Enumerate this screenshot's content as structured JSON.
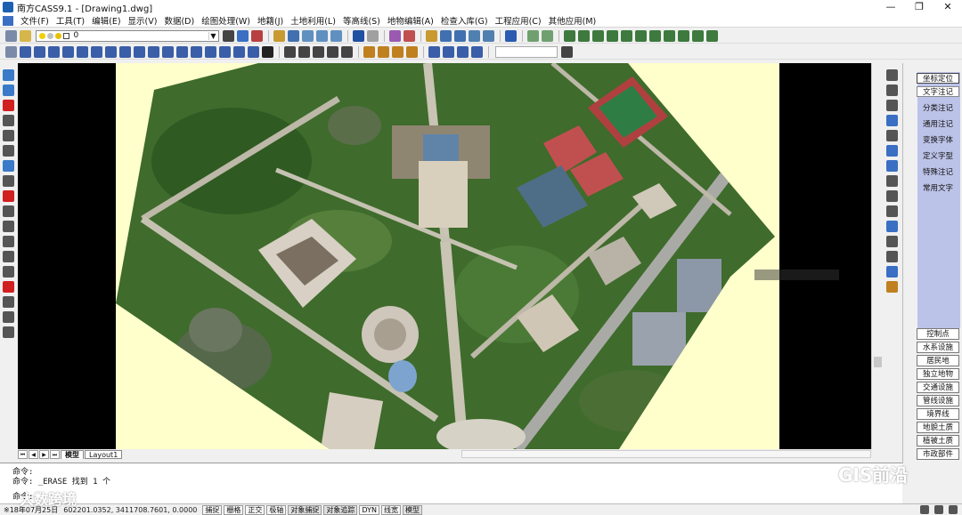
{
  "window": {
    "title": "南方CASS9.1 - [Drawing1.dwg]",
    "controls": [
      "—",
      "❐",
      "✕"
    ]
  },
  "menu": {
    "items": [
      "文件(F)",
      "工具(T)",
      "编辑(E)",
      "显示(V)",
      "数据(D)",
      "绘图处理(W)",
      "地籍(J)",
      "土地利用(L)",
      "等高线(S)",
      "地物编辑(A)",
      "检查入库(G)",
      "工程应用(C)",
      "其他应用(M)"
    ]
  },
  "toolbar": {
    "layer_value": "0"
  },
  "side_panel": {
    "top_buttons": [
      "坐标定位",
      "文字注记",
      "分类注记",
      "通用注记",
      "变换字体",
      "定义字型",
      "特殊注记",
      "常用文字"
    ],
    "selected_top": "坐标定位",
    "bottom_buttons": [
      "控制点",
      "水系设施",
      "居民地",
      "独立地物",
      "交通设施",
      "管线设施",
      "境界线",
      "地貌土质",
      "植被土质",
      "市政部件"
    ]
  },
  "tabs": {
    "nav": [
      "⏮",
      "◀",
      "▶",
      "⏭"
    ],
    "items": [
      "模型",
      "Layout1"
    ],
    "active": "模型"
  },
  "command": {
    "line1": "命令:",
    "line2": "命令:  _ERASE 找到 1 个",
    "line3": "命令:"
  },
  "status": {
    "coords": "602201.0352, 3411708.7601, 0.0000",
    "date_prefix": "※18年07月25日",
    "buttons": [
      {
        "label": "捕捉",
        "on": false
      },
      {
        "label": "栅格",
        "on": false
      },
      {
        "label": "正交",
        "on": false
      },
      {
        "label": "极轴",
        "on": false
      },
      {
        "label": "对象捕捉",
        "on": true
      },
      {
        "label": "对象追踪",
        "on": true
      },
      {
        "label": "DYN",
        "on": false
      },
      {
        "label": "线宽",
        "on": false
      },
      {
        "label": "模型",
        "on": true
      }
    ]
  },
  "watermarks": {
    "left": "大数跨境",
    "right": "GIS前沿"
  },
  "colors": {
    "paper": "#ffffcc",
    "canvas_bg": "#000000",
    "palette_bg": "#bcc3e8"
  }
}
